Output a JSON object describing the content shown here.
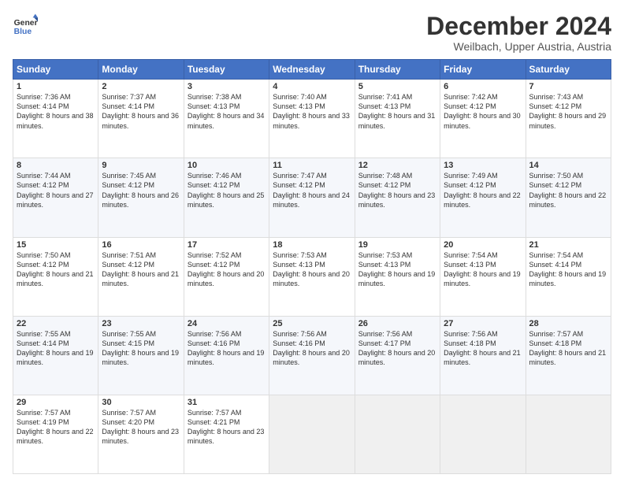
{
  "header": {
    "logo_line1": "General",
    "logo_line2": "Blue",
    "month_title": "December 2024",
    "location": "Weilbach, Upper Austria, Austria"
  },
  "weekdays": [
    "Sunday",
    "Monday",
    "Tuesday",
    "Wednesday",
    "Thursday",
    "Friday",
    "Saturday"
  ],
  "weeks": [
    [
      {
        "day": "1",
        "sunrise": "Sunrise: 7:36 AM",
        "sunset": "Sunset: 4:14 PM",
        "daylight": "Daylight: 8 hours and 38 minutes."
      },
      {
        "day": "2",
        "sunrise": "Sunrise: 7:37 AM",
        "sunset": "Sunset: 4:14 PM",
        "daylight": "Daylight: 8 hours and 36 minutes."
      },
      {
        "day": "3",
        "sunrise": "Sunrise: 7:38 AM",
        "sunset": "Sunset: 4:13 PM",
        "daylight": "Daylight: 8 hours and 34 minutes."
      },
      {
        "day": "4",
        "sunrise": "Sunrise: 7:40 AM",
        "sunset": "Sunset: 4:13 PM",
        "daylight": "Daylight: 8 hours and 33 minutes."
      },
      {
        "day": "5",
        "sunrise": "Sunrise: 7:41 AM",
        "sunset": "Sunset: 4:13 PM",
        "daylight": "Daylight: 8 hours and 31 minutes."
      },
      {
        "day": "6",
        "sunrise": "Sunrise: 7:42 AM",
        "sunset": "Sunset: 4:12 PM",
        "daylight": "Daylight: 8 hours and 30 minutes."
      },
      {
        "day": "7",
        "sunrise": "Sunrise: 7:43 AM",
        "sunset": "Sunset: 4:12 PM",
        "daylight": "Daylight: 8 hours and 29 minutes."
      }
    ],
    [
      {
        "day": "8",
        "sunrise": "Sunrise: 7:44 AM",
        "sunset": "Sunset: 4:12 PM",
        "daylight": "Daylight: 8 hours and 27 minutes."
      },
      {
        "day": "9",
        "sunrise": "Sunrise: 7:45 AM",
        "sunset": "Sunset: 4:12 PM",
        "daylight": "Daylight: 8 hours and 26 minutes."
      },
      {
        "day": "10",
        "sunrise": "Sunrise: 7:46 AM",
        "sunset": "Sunset: 4:12 PM",
        "daylight": "Daylight: 8 hours and 25 minutes."
      },
      {
        "day": "11",
        "sunrise": "Sunrise: 7:47 AM",
        "sunset": "Sunset: 4:12 PM",
        "daylight": "Daylight: 8 hours and 24 minutes."
      },
      {
        "day": "12",
        "sunrise": "Sunrise: 7:48 AM",
        "sunset": "Sunset: 4:12 PM",
        "daylight": "Daylight: 8 hours and 23 minutes."
      },
      {
        "day": "13",
        "sunrise": "Sunrise: 7:49 AM",
        "sunset": "Sunset: 4:12 PM",
        "daylight": "Daylight: 8 hours and 22 minutes."
      },
      {
        "day": "14",
        "sunrise": "Sunrise: 7:50 AM",
        "sunset": "Sunset: 4:12 PM",
        "daylight": "Daylight: 8 hours and 22 minutes."
      }
    ],
    [
      {
        "day": "15",
        "sunrise": "Sunrise: 7:50 AM",
        "sunset": "Sunset: 4:12 PM",
        "daylight": "Daylight: 8 hours and 21 minutes."
      },
      {
        "day": "16",
        "sunrise": "Sunrise: 7:51 AM",
        "sunset": "Sunset: 4:12 PM",
        "daylight": "Daylight: 8 hours and 21 minutes."
      },
      {
        "day": "17",
        "sunrise": "Sunrise: 7:52 AM",
        "sunset": "Sunset: 4:12 PM",
        "daylight": "Daylight: 8 hours and 20 minutes."
      },
      {
        "day": "18",
        "sunrise": "Sunrise: 7:53 AM",
        "sunset": "Sunset: 4:13 PM",
        "daylight": "Daylight: 8 hours and 20 minutes."
      },
      {
        "day": "19",
        "sunrise": "Sunrise: 7:53 AM",
        "sunset": "Sunset: 4:13 PM",
        "daylight": "Daylight: 8 hours and 19 minutes."
      },
      {
        "day": "20",
        "sunrise": "Sunrise: 7:54 AM",
        "sunset": "Sunset: 4:13 PM",
        "daylight": "Daylight: 8 hours and 19 minutes."
      },
      {
        "day": "21",
        "sunrise": "Sunrise: 7:54 AM",
        "sunset": "Sunset: 4:14 PM",
        "daylight": "Daylight: 8 hours and 19 minutes."
      }
    ],
    [
      {
        "day": "22",
        "sunrise": "Sunrise: 7:55 AM",
        "sunset": "Sunset: 4:14 PM",
        "daylight": "Daylight: 8 hours and 19 minutes."
      },
      {
        "day": "23",
        "sunrise": "Sunrise: 7:55 AM",
        "sunset": "Sunset: 4:15 PM",
        "daylight": "Daylight: 8 hours and 19 minutes."
      },
      {
        "day": "24",
        "sunrise": "Sunrise: 7:56 AM",
        "sunset": "Sunset: 4:16 PM",
        "daylight": "Daylight: 8 hours and 19 minutes."
      },
      {
        "day": "25",
        "sunrise": "Sunrise: 7:56 AM",
        "sunset": "Sunset: 4:16 PM",
        "daylight": "Daylight: 8 hours and 20 minutes."
      },
      {
        "day": "26",
        "sunrise": "Sunrise: 7:56 AM",
        "sunset": "Sunset: 4:17 PM",
        "daylight": "Daylight: 8 hours and 20 minutes."
      },
      {
        "day": "27",
        "sunrise": "Sunrise: 7:56 AM",
        "sunset": "Sunset: 4:18 PM",
        "daylight": "Daylight: 8 hours and 21 minutes."
      },
      {
        "day": "28",
        "sunrise": "Sunrise: 7:57 AM",
        "sunset": "Sunset: 4:18 PM",
        "daylight": "Daylight: 8 hours and 21 minutes."
      }
    ],
    [
      {
        "day": "29",
        "sunrise": "Sunrise: 7:57 AM",
        "sunset": "Sunset: 4:19 PM",
        "daylight": "Daylight: 8 hours and 22 minutes."
      },
      {
        "day": "30",
        "sunrise": "Sunrise: 7:57 AM",
        "sunset": "Sunset: 4:20 PM",
        "daylight": "Daylight: 8 hours and 23 minutes."
      },
      {
        "day": "31",
        "sunrise": "Sunrise: 7:57 AM",
        "sunset": "Sunset: 4:21 PM",
        "daylight": "Daylight: 8 hours and 23 minutes."
      },
      null,
      null,
      null,
      null
    ]
  ]
}
